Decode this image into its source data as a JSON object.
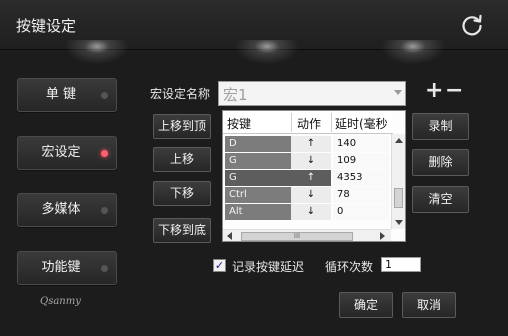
{
  "window": {
    "title": "按键设定",
    "refresh_icon": "refresh-icon"
  },
  "sidebar": {
    "items": [
      {
        "label": "单  键",
        "active": false
      },
      {
        "label": "宏设定",
        "active": true
      },
      {
        "label": "多媒体",
        "active": false
      },
      {
        "label": "功能键",
        "active": false
      }
    ],
    "logo": "Qsanmy"
  },
  "macro": {
    "name_label": "宏设定名称",
    "name_value": "宏1",
    "plus": "+",
    "minus": "−"
  },
  "left_buttons": {
    "move_top": "上移到顶",
    "move_up": "上移",
    "move_down": "下移",
    "move_bottom": "下移到底"
  },
  "right_buttons": {
    "record": "录制",
    "delete": "删除",
    "clear": "清空"
  },
  "table": {
    "columns": [
      "按键",
      "动作",
      "延时(毫秒"
    ],
    "rows": [
      {
        "key": "D",
        "action": "↑",
        "delay": "140"
      },
      {
        "key": "G",
        "action": "↓",
        "delay": "109"
      },
      {
        "key": "G",
        "action": "↑",
        "delay": "4353"
      },
      {
        "key": "Ctrl",
        "action": "↓",
        "delay": "78"
      },
      {
        "key": "Alt",
        "action": "↓",
        "delay": "0"
      }
    ],
    "hscroll_grip": "III"
  },
  "options": {
    "record_delay_label": "记录按键延迟",
    "record_delay_checked": true,
    "loop_label": "循环次数",
    "loop_value": "1"
  },
  "footer": {
    "ok": "确定",
    "cancel": "取消"
  },
  "colors": {
    "led_active": "#ff5f6f",
    "background": "#1c1c1c"
  }
}
